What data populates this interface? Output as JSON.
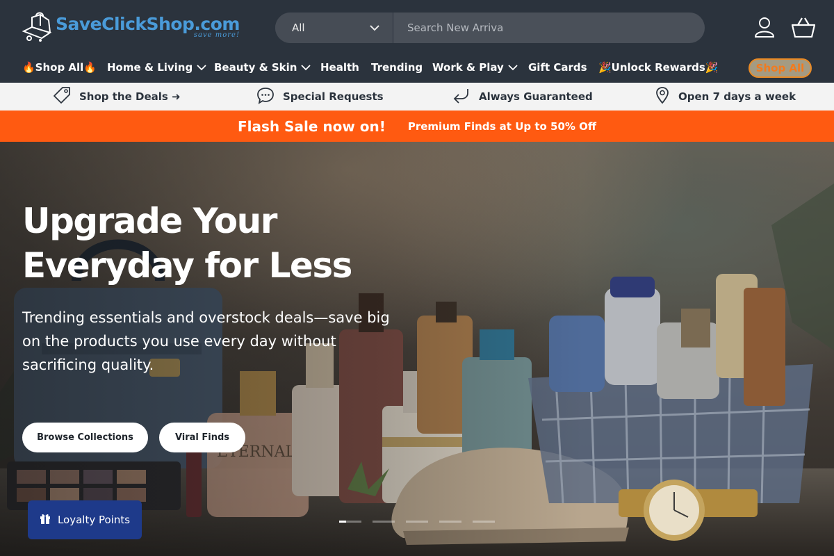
{
  "brand": {
    "name": "SaveClickShop.com",
    "tagline": "save more!",
    "color": "#4a9bd9"
  },
  "search": {
    "category": "All",
    "placeholder": "Search New Arriva"
  },
  "header_icons": [
    "account-icon",
    "cart-icon"
  ],
  "nav": {
    "items": [
      {
        "label": "🔥Shop All🔥",
        "dropdown": false
      },
      {
        "label": "Home & Living",
        "dropdown": true
      },
      {
        "label": "Beauty & Skin",
        "dropdown": true
      },
      {
        "label": "Health",
        "dropdown": false
      },
      {
        "label": "Trending",
        "dropdown": false
      },
      {
        "label": "Work & Play",
        "dropdown": true
      },
      {
        "label": "Gift Cards",
        "dropdown": false
      },
      {
        "label": "🎉Unlock Rewards🎉",
        "dropdown": false
      }
    ],
    "cta_label": "Shop All"
  },
  "benefits": [
    {
      "icon": "tag-icon",
      "label": "Shop the Deals ➜"
    },
    {
      "icon": "chat-icon",
      "label": "Special Requests"
    },
    {
      "icon": "return-arrow-icon",
      "label": "Always Guaranteed"
    },
    {
      "icon": "location-pin-icon",
      "label": "Open 7 days a week"
    }
  ],
  "flash_sale": {
    "title": "Flash Sale now on!",
    "subtitle": "Premium Finds at Up to 50% Off",
    "color": "#ff5a11"
  },
  "hero": {
    "title": "Upgrade Your Everyday for Less",
    "subtitle": "Trending essentials and overstock deals—save big on the products you use every day without sacrificing quality.",
    "buttons": [
      "Browse Collections",
      "Viral Finds"
    ],
    "slide_count": 5,
    "active_slide": 1
  },
  "loyalty": {
    "label": "Loyalty Points",
    "icon": "gift-icon",
    "color": "#1e3a8a"
  }
}
